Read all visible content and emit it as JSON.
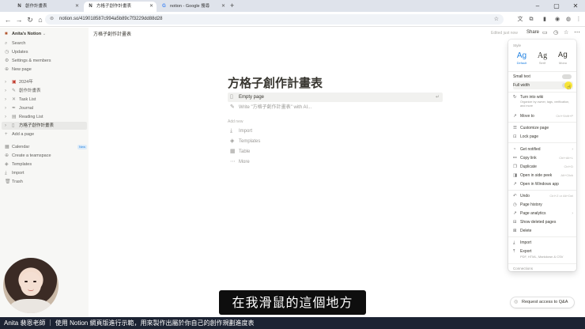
{
  "browser": {
    "tabs": [
      {
        "label": "創作計畫表",
        "icon": "notion-tab-icon",
        "active": false
      },
      {
        "label": "方格子創作計畫表",
        "icon": "notion-tab-icon",
        "active": true
      },
      {
        "label": "notion - Google 搜尋",
        "icon": "google-tab-icon",
        "active": false
      }
    ],
    "url": "notion.so/419018587c994a5b89c7f3229dd88d28"
  },
  "sidebar": {
    "workspace": "Anita's Notion",
    "top_items": [
      {
        "label": "Search",
        "icon": "search-icon"
      },
      {
        "label": "Updates",
        "icon": "clock-icon"
      },
      {
        "label": "Settings & members",
        "icon": "gear-icon"
      },
      {
        "label": "New page",
        "icon": "plus-circle-icon"
      }
    ],
    "pages": [
      {
        "label": "2024年"
      },
      {
        "label": "創作計畫表"
      },
      {
        "label": "Task List"
      },
      {
        "label": "Journal"
      },
      {
        "label": "Reading List"
      },
      {
        "label": "方格子創作計畫表"
      }
    ],
    "add_page": "Add a page",
    "bottom_items": [
      {
        "label": "Calendar"
      },
      {
        "label": "Create a teamspace"
      },
      {
        "label": "Templates"
      },
      {
        "label": "Import"
      },
      {
        "label": "Trash"
      }
    ],
    "calendar_badge": "New"
  },
  "topbar": {
    "breadcrumb": "方格子創作計畫表",
    "edited": "Edited just now",
    "share": "Share"
  },
  "page": {
    "title": "方格子創作計畫表",
    "empty_page": "Empty page",
    "ai_prompt": "Write \"方格子創作計畫表\" with AI...",
    "add_new": "Add new",
    "options": [
      "Import",
      "Templates",
      "Table",
      "More"
    ]
  },
  "menu": {
    "style_label": "Style",
    "styles": [
      {
        "sample": "Ag",
        "name": "Default"
      },
      {
        "sample": "Ag",
        "name": "Serif"
      },
      {
        "sample": "Ag",
        "name": "Mono"
      }
    ],
    "small_text": "Small text",
    "full_width": "Full width",
    "turn_into_wiki": "Turn into wiki",
    "wiki_desc": "Organize by owner, tags, verification, and more",
    "move_to": "Move to",
    "move_to_shortcut": "Ctrl+Shift+P",
    "customize_page": "Customize page",
    "lock_page": "Lock page",
    "get_notified": "Get notified",
    "copy_link": "Copy link",
    "copy_link_shortcut": "Ctrl+Alt+L",
    "duplicate": "Duplicate",
    "duplicate_shortcut": "Ctrl+D",
    "open_side_peek": "Open in side peek",
    "open_side_peek_shortcut": "Alt+Click",
    "open_windows_app": "Open in Windows app",
    "undo": "Undo",
    "undo_shortcut": "Ctrl+Z or Alt+Del",
    "page_history": "Page history",
    "page_analytics": "Page analytics",
    "show_deleted": "Show deleted pages",
    "delete": "Delete",
    "import": "Import",
    "export": "Export",
    "export_desc": "PDF, HTML, Markdown & CSV",
    "connections": "Connections"
  },
  "request_access": "Request access to Q&A",
  "caption": "在我滑鼠的這個地方",
  "footer": "Anita 裴恩老師 ｜ 使用 Notion 網頁版進行示範，用來製作出屬於你自己的創作規劃進度表",
  "colors": {
    "accent": "#2383e2",
    "footer_bg": "#1c2333",
    "sidebar_bg": "#f7f7f5"
  }
}
